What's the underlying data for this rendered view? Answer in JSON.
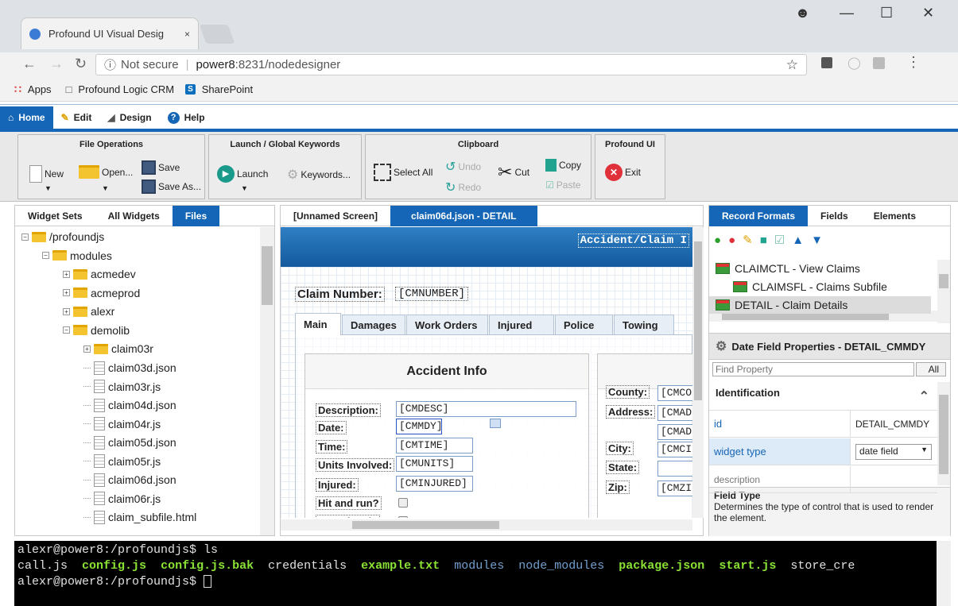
{
  "browser": {
    "tab_title": "Profound UI Visual Desig",
    "tab_close": "×",
    "url_security": "Not secure",
    "url_host": "power8",
    "url_path": ":8231/nodedesigner",
    "bookmarks": [
      "Apps",
      "Profound Logic CRM",
      "SharePoint"
    ],
    "sharepoint_badge": "S"
  },
  "menu": {
    "items": [
      "Home",
      "Edit",
      "Design",
      "Help"
    ]
  },
  "ribbon": {
    "file_ops": {
      "title": "File Operations",
      "new": "New",
      "open": "Open...",
      "save": "Save",
      "save_as": "Save As..."
    },
    "launch": {
      "title": "Launch / Global Keywords",
      "launch": "Launch",
      "keywords": "Keywords..."
    },
    "clipboard": {
      "title": "Clipboard",
      "select_all": "Select All",
      "undo": "Undo",
      "redo": "Redo",
      "cut": "Cut",
      "copy": "Copy",
      "paste": "Paste"
    },
    "profound": {
      "title": "Profound UI",
      "exit": "Exit"
    }
  },
  "left_panel": {
    "tabs": [
      "Widget Sets",
      "All Widgets",
      "Files"
    ],
    "tree": [
      {
        "label": "/profoundjs",
        "type": "folder",
        "depth": 0,
        "expander": "-"
      },
      {
        "label": "modules",
        "type": "folder",
        "depth": 1,
        "expander": "-"
      },
      {
        "label": "acmedev",
        "type": "folder",
        "depth": 2,
        "expander": "+"
      },
      {
        "label": "acmeprod",
        "type": "folder",
        "depth": 2,
        "expander": "+"
      },
      {
        "label": "alexr",
        "type": "folder",
        "depth": 2,
        "expander": "+"
      },
      {
        "label": "demolib",
        "type": "folder",
        "depth": 2,
        "expander": "-"
      },
      {
        "label": "claim03r",
        "type": "folder",
        "depth": 3,
        "expander": "+"
      },
      {
        "label": "claim03d.json",
        "type": "file",
        "depth": 3
      },
      {
        "label": "claim03r.js",
        "type": "file",
        "depth": 3
      },
      {
        "label": "claim04d.json",
        "type": "file",
        "depth": 3
      },
      {
        "label": "claim04r.js",
        "type": "file",
        "depth": 3
      },
      {
        "label": "claim05d.json",
        "type": "file",
        "depth": 3
      },
      {
        "label": "claim05r.js",
        "type": "file",
        "depth": 3
      },
      {
        "label": "claim06d.json",
        "type": "file",
        "depth": 3
      },
      {
        "label": "claim06r.js",
        "type": "file",
        "depth": 3
      },
      {
        "label": "claim_subfile.html",
        "type": "file",
        "depth": 3
      }
    ]
  },
  "center_panel": {
    "tabs": [
      "[Unnamed Screen]",
      "claim06d.json - DETAIL"
    ],
    "header_text": "Accident/Claim I",
    "claim_label": "Claim Number:",
    "claim_field": "[CMNUMBER]",
    "content_tabs": [
      "Main",
      "Damages",
      "Work Orders",
      "Injured",
      "Police",
      "Towing"
    ],
    "section_title": "Accident Info",
    "rows": [
      {
        "label": "Description:",
        "value": "[CMDESC]"
      },
      {
        "label": "Date:",
        "value": "[CMMDY]"
      },
      {
        "label": "Time:",
        "value": "[CMTIME]"
      },
      {
        "label": "Units Involved:",
        "value": "[CMUNITS]"
      },
      {
        "label": "Injured:",
        "value": "[CMINJURED]"
      }
    ],
    "check_rows": [
      "Hit and run?",
      "Completed?"
    ],
    "right_rows": [
      {
        "label": "County:",
        "value": "[CMCO"
      },
      {
        "label": "Address:",
        "value": "[CMAD"
      },
      {
        "label": "",
        "value": "[CMAD"
      },
      {
        "label": "City:",
        "value": "[CMCI"
      },
      {
        "label": "State:",
        "value": ""
      },
      {
        "label": "Zip:",
        "value": "[CMZI"
      }
    ]
  },
  "right_panel": {
    "tabs": [
      "Record Formats",
      "Fields",
      "Elements"
    ],
    "formats": [
      "CLAIMCTL - View Claims",
      "CLAIMSFL - Claims Subfile",
      "DETAIL - Claim Details"
    ],
    "props_title": "Date Field Properties - DETAIL_CMMDY",
    "find_placeholder": "Find Property",
    "find_filter": "All",
    "section": "Identification",
    "props": [
      {
        "name": "id",
        "value": "DETAIL_CMMDY"
      },
      {
        "name": "widget type",
        "value": "date field"
      },
      {
        "name": "description",
        "value": ""
      }
    ],
    "help_title": "Field Type",
    "help_text": "Determines the type of control that is used to render the element."
  },
  "terminal": {
    "prompt": "alexr@power8:/profoundjs$ ",
    "command": "ls",
    "listing": [
      {
        "name": "call.js",
        "kind": "plain"
      },
      {
        "name": "config.js",
        "kind": "exec"
      },
      {
        "name": "config.js.bak",
        "kind": "exec"
      },
      {
        "name": "credentials",
        "kind": "plain"
      },
      {
        "name": "example.txt",
        "kind": "exec"
      },
      {
        "name": "modules",
        "kind": "dir"
      },
      {
        "name": "node_modules",
        "kind": "dir"
      },
      {
        "name": "package.json",
        "kind": "exec"
      },
      {
        "name": "start.js",
        "kind": "exec"
      },
      {
        "name": "store_cre",
        "kind": "plain"
      }
    ]
  },
  "colors": {
    "accent": "#1566b6",
    "exec": "#8ae234",
    "dir": "#729fcf"
  }
}
